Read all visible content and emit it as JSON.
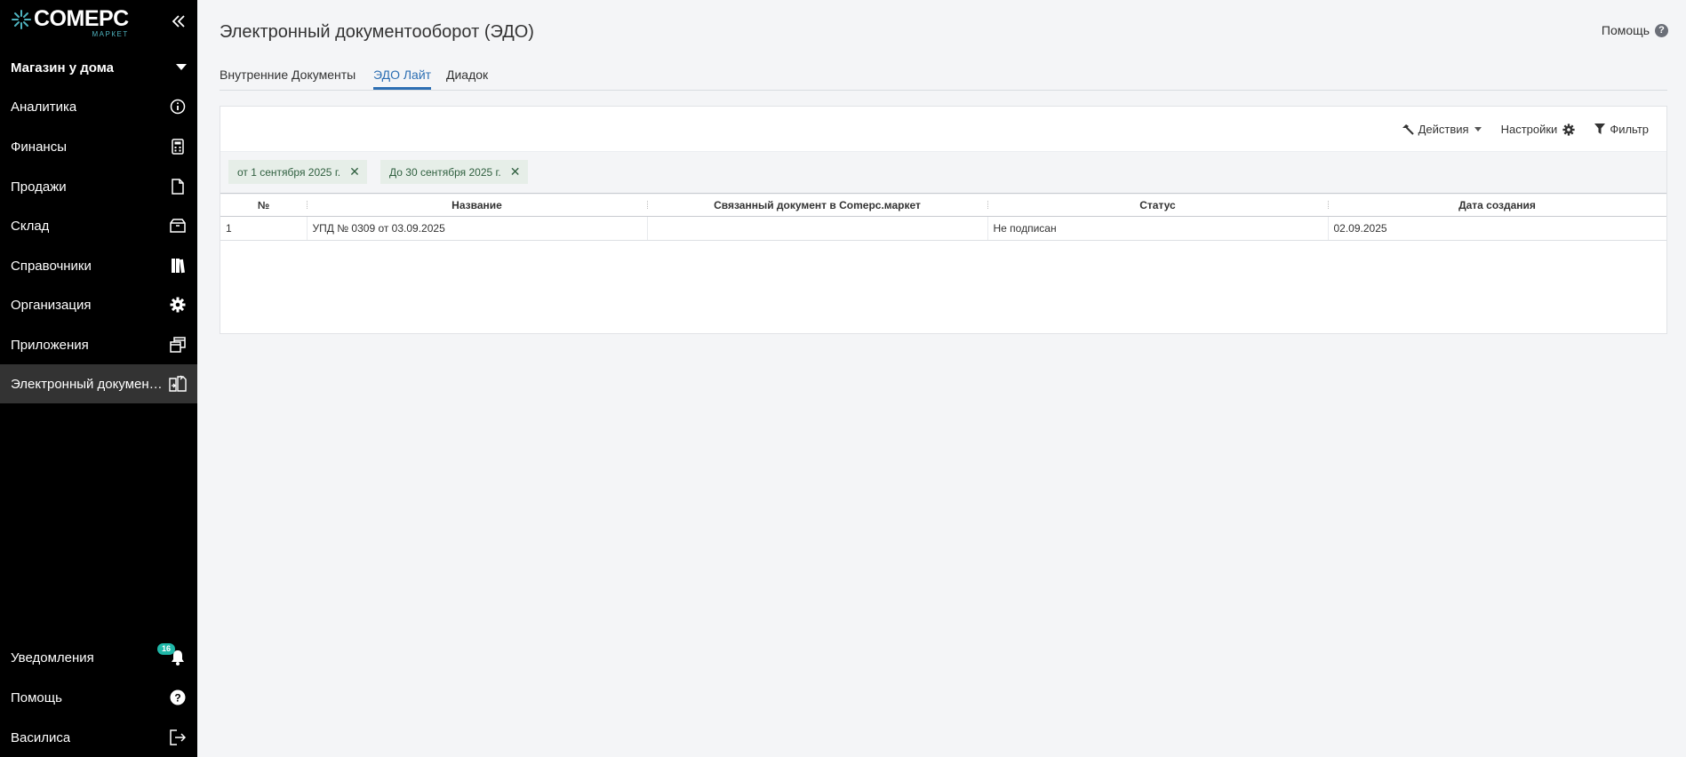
{
  "logo": {
    "main": "COMEPC",
    "sub": "МАРКЕТ"
  },
  "store": {
    "name": "Магазин у дома"
  },
  "sidebar": {
    "items": [
      {
        "label": "Аналитика",
        "icon": "info-icon"
      },
      {
        "label": "Финансы",
        "icon": "calculator-icon"
      },
      {
        "label": "Продажи",
        "icon": "document-icon"
      },
      {
        "label": "Склад",
        "icon": "box-icon"
      },
      {
        "label": "Справочники",
        "icon": "books-icon"
      },
      {
        "label": "Организация",
        "icon": "gear-icon"
      },
      {
        "label": "Приложения",
        "icon": "windows-icon"
      },
      {
        "label": "Электронный документооборот",
        "icon": "docs-exchange-icon"
      }
    ],
    "bottom": [
      {
        "label": "Уведомления",
        "icon": "bell-icon"
      },
      {
        "label": "Помощь",
        "icon": "help-icon"
      },
      {
        "label": "Василиса",
        "icon": "logout-icon"
      }
    ],
    "notification_count": "16"
  },
  "header": {
    "title": "Электронный документооборот (ЭДО)",
    "help": "Помощь"
  },
  "tabs": [
    {
      "label": "Внутренние Документы"
    },
    {
      "label": "ЭДО Лайт"
    },
    {
      "label": "Диадок"
    }
  ],
  "toolbar": {
    "actions": "Действия",
    "settings": "Настройки",
    "filter": "Фильтр"
  },
  "filters": [
    {
      "label": "от 1 сентября 2025 г."
    },
    {
      "label": "До 30 сентября 2025 г."
    }
  ],
  "table": {
    "columns": [
      "№",
      "Название",
      "Связанный документ в Comepc.маркет",
      "Статус",
      "Дата создания"
    ],
    "rows": [
      [
        "1",
        "УПД № 0309 от 03.09.2025",
        "",
        "Не подписан",
        "02.09.2025"
      ]
    ]
  },
  "colors": {
    "accent": "#2d6fb3",
    "sidebar_bg": "#000000",
    "badge": "#1fb7a8",
    "chip_bg": "#e6eee8"
  }
}
